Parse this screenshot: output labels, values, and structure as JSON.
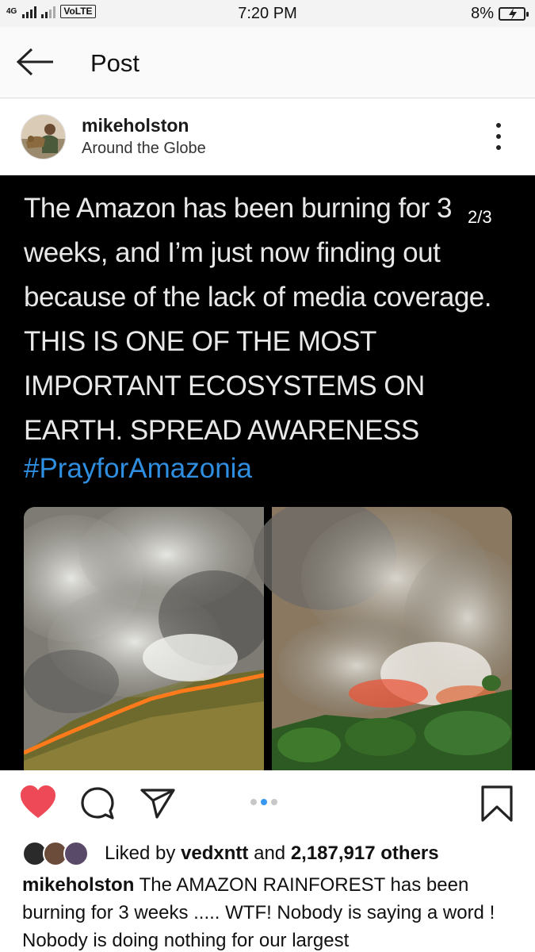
{
  "status_bar": {
    "network_label": "4G",
    "volte_label": "VoLTE",
    "time": "7:20 PM",
    "battery_percent": "8%",
    "battery_level": 0.08
  },
  "header": {
    "title": "Post",
    "back_icon": "arrow-left-icon"
  },
  "post": {
    "username": "mikeholston",
    "location": "Around the Globe",
    "more_icon": "vertical-dots-icon",
    "image": {
      "counter": "2/3",
      "tweet_text": "The Amazon has been burning for 3 weeks, and I’m just now finding out because of the lack of media coverage. THIS IS ONE OF THE MOST IMPORTANT ECOSYSTEMS ON EARTH. SPREAD AWARENESS",
      "hashtag": "#PrayforAmazonia"
    },
    "actions": {
      "like_icon": "heart-filled-icon",
      "comment_icon": "comment-icon",
      "share_icon": "send-icon",
      "bookmark_icon": "bookmark-icon",
      "carousel_total": 3,
      "carousel_active": 2,
      "like_color": "#ed4956",
      "dot_active_color": "#3897f0"
    },
    "likes": {
      "prefix": "Liked by",
      "first_user": "vedxntt",
      "connector": "and",
      "others": "2,187,917 others"
    },
    "caption": {
      "username": "mikeholston",
      "text": "The AMAZON RAINFOREST has been burning for 3 weeks ..... WTF! Nobody is saying a word ! Nobody is doing nothing for our largest"
    }
  }
}
